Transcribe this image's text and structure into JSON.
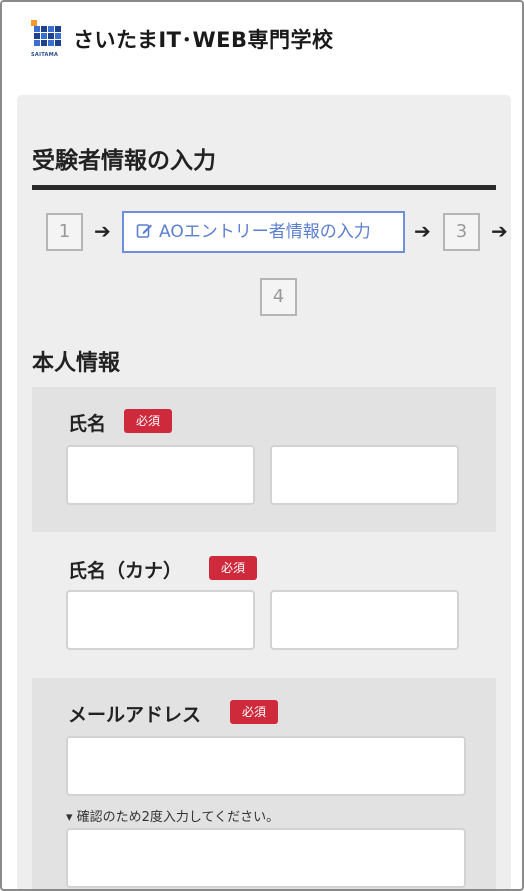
{
  "header": {
    "logo_text": "さいたまIT･WEB専門学校",
    "logo_sub": "SAITAMA"
  },
  "page": {
    "title": "受験者情報の入力"
  },
  "steps": {
    "step1": "1",
    "step2_label": "AOエントリー者情報の入力",
    "step3": "3",
    "step4": "4",
    "arrow": "➔"
  },
  "section": {
    "title": "本人情報"
  },
  "fields": {
    "name_label": "氏名",
    "name_kana_label": "氏名（カナ）",
    "email_label": "メールアドレス",
    "required_badge": "必須",
    "email_confirm_hint": "▾ 確認のため2度入力してください。"
  },
  "colors": {
    "accent_blue": "#6f8fd9",
    "required_red": "#cf2a3c",
    "panel_bg": "#eeeeee"
  }
}
